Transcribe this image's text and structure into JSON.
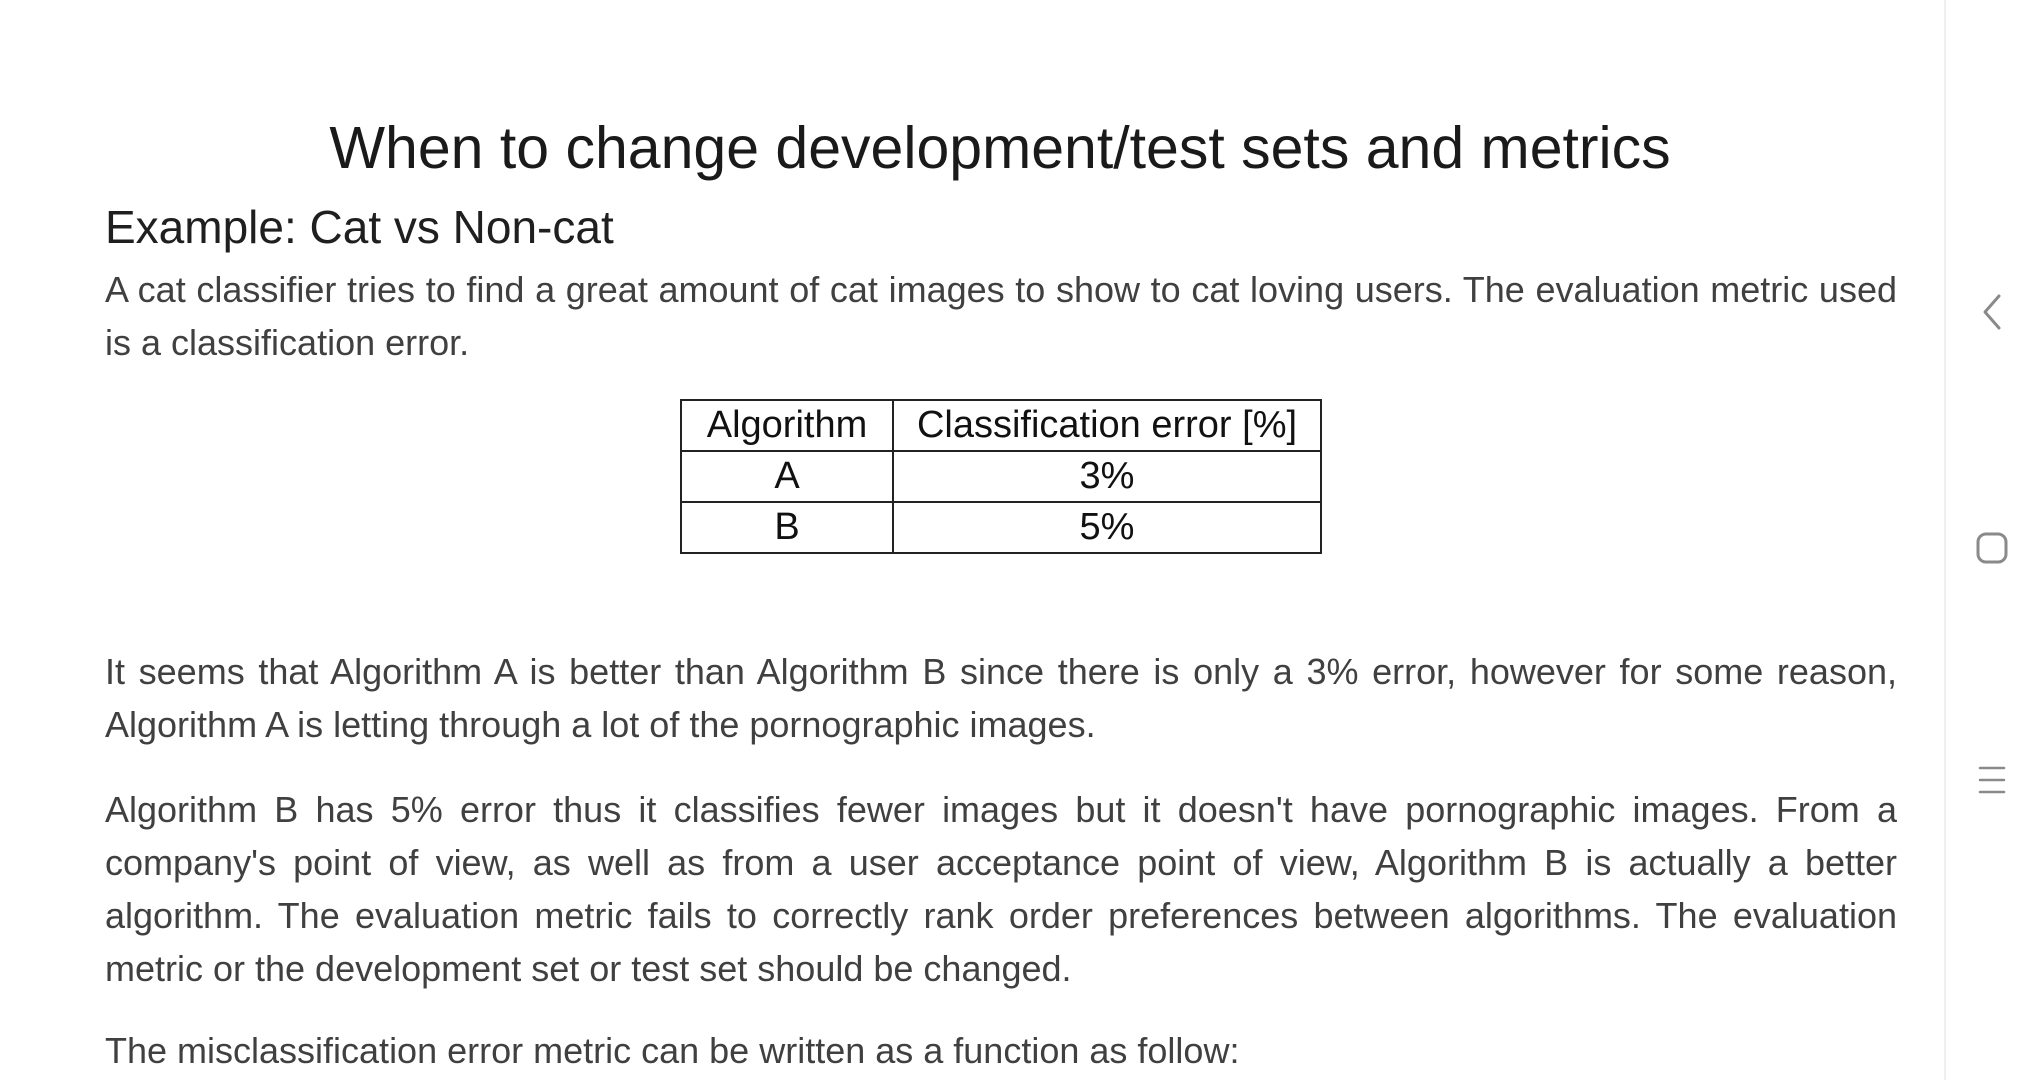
{
  "document": {
    "title": "When to change development/test sets and metrics",
    "subtitle": "Example: Cat vs Non-cat",
    "intro": "A cat classifier tries to find a great amount of cat images to show to cat loving users. The evaluation metric used is a classification error.",
    "table": {
      "headers": [
        "Algorithm",
        "Classification error [%]"
      ],
      "rows": [
        [
          "A",
          "3%"
        ],
        [
          "B",
          "5%"
        ]
      ]
    },
    "paragraph_1": "It seems that Algorithm A is better than Algorithm B since there is only a 3% error, however for some reason, Algorithm A is letting through a lot of the pornographic images.",
    "paragraph_2": "Algorithm B has 5% error thus it classifies fewer images but it doesn't have pornographic images. From a company's point of view, as well as from a user acceptance point of view, Algorithm B is actually a better algorithm.  The evaluation metric fails to correctly rank order preferences between algorithms. The evaluation metric or the development set or test set should be changed.",
    "paragraph_3": "The misclassification error metric can be written as a function as follow:"
  },
  "navigation": {
    "back_icon": "chevron-left-icon",
    "home_icon": "rounded-square-icon",
    "recents_icon": "three-lines-icon",
    "icon_color": "#8a8a8a"
  }
}
